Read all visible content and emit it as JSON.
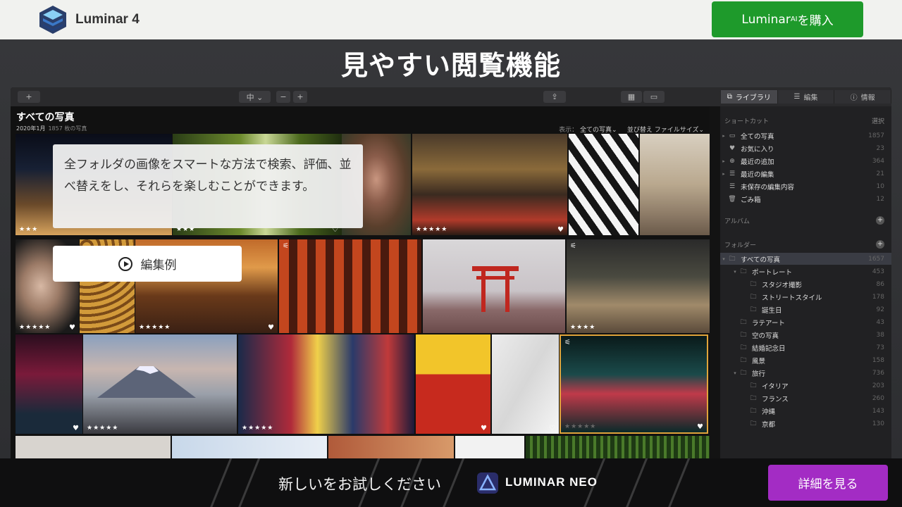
{
  "header": {
    "brand": "Luminar 4",
    "buy_prefix": "Luminar",
    "buy_sup": "AI",
    "buy_suffix": "を購入"
  },
  "hero": {
    "title": "見やすい閲覧機能"
  },
  "toolbar": {
    "add": "+",
    "size": "中 ⌄",
    "minus": "−",
    "plus": "+",
    "share": "⇪"
  },
  "tabs": [
    {
      "label": "ライブラリ",
      "icon": "library-icon",
      "active": true
    },
    {
      "label": "編集",
      "icon": "sliders-icon",
      "active": false
    },
    {
      "label": "情報",
      "icon": "info-icon",
      "active": false
    }
  ],
  "grid": {
    "title": "すべての写真",
    "date": "2020年1月",
    "count": "1857 枚の写真",
    "view_label": "表示：",
    "view_value": "全ての写真⌄",
    "sort_label": "並び替え",
    "sort_value": "ファイルサイズ⌄"
  },
  "ratings": {
    "r3": "★★★",
    "r3b": "★★★",
    "r5a": "★★★★★",
    "r5b": "★★★★★",
    "r5c": "★★★★★",
    "r4": "★★★★",
    "r5d": "★★★★★",
    "r5e": "★★★★★",
    "r4b": "★★★★★"
  },
  "callout": {
    "text": "全フォルダの画像をスマートな方法で検索、評価、並べ替えをし、それらを楽しむことができます。"
  },
  "demo": {
    "label": "編集例"
  },
  "sidebar": {
    "shortcuts_title": "ショートカット",
    "select": "選択",
    "shortcuts": [
      {
        "label": "全ての写真",
        "count": "1857",
        "icon": "stack-icon"
      },
      {
        "label": "お気に入り",
        "count": "23",
        "icon": "heart-icon"
      },
      {
        "label": "最近の追加",
        "count": "364",
        "icon": "add-circle-icon"
      },
      {
        "label": "最近の編集",
        "count": "21",
        "icon": "sliders-icon"
      },
      {
        "label": "未保存の編集内容",
        "count": "10",
        "icon": "sliders-icon"
      },
      {
        "label": "ごみ箱",
        "count": "12",
        "icon": "trash-icon"
      }
    ],
    "albums_title": "アルバム",
    "folders_title": "フォルダー",
    "folders": [
      {
        "label": "すべての写真",
        "count": "1657",
        "level": 0,
        "selected": true
      },
      {
        "label": "ポートレート",
        "count": "453",
        "level": 1
      },
      {
        "label": "スタジオ撮影",
        "count": "86",
        "level": 2
      },
      {
        "label": "ストリートスタイル",
        "count": "178",
        "level": 2
      },
      {
        "label": "誕生日",
        "count": "92",
        "level": 2
      },
      {
        "label": "ラテアート",
        "count": "43",
        "level": 1
      },
      {
        "label": "空の写真",
        "count": "38",
        "level": 1
      },
      {
        "label": "結婚記念日",
        "count": "73",
        "level": 1
      },
      {
        "label": "風景",
        "count": "158",
        "level": 1
      },
      {
        "label": "旅行",
        "count": "736",
        "level": 1
      },
      {
        "label": "イタリア",
        "count": "203",
        "level": 2
      },
      {
        "label": "フランス",
        "count": "260",
        "level": 2
      },
      {
        "label": "沖縄",
        "count": "143",
        "level": 2
      },
      {
        "label": "京都",
        "count": "130",
        "level": 2
      }
    ]
  },
  "banner": {
    "try": "新しいをお試しください",
    "neo": "LUMINAR NEO",
    "more": "詳細を見る"
  },
  "colors": {
    "buy": "#1e9a2b",
    "more": "#a32cc4",
    "selected_tile": "#e0a43a"
  }
}
